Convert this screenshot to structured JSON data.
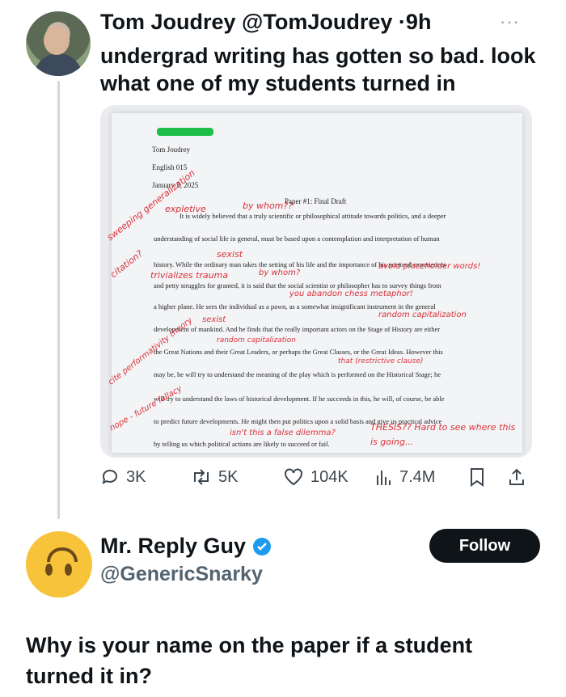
{
  "tweet": {
    "author_name": "Tom Joudrey",
    "author_handle": "@TomJoudrey",
    "separator": "·",
    "time": "9h",
    "text": "undergrad writing has gotten so bad. look what one of my students turned in",
    "more_icon": "more-dots-icon"
  },
  "paper": {
    "header_lines": [
      "Tom Joudrey",
      "English 015",
      "January 5, 2025"
    ],
    "title": "Paper #1: Final Draft",
    "body_lines": [
      "It is widely believed that a truly scientific or philosophical attitude towards politics, and a deeper",
      "understanding of social life in general, must be based upon a contemplation and interpretation of human",
      "history. While the ordinary man takes the setting of his life and the importance of his personal experiences",
      "and petty struggles for granted, it is said that the social scientist or philosopher has to survey things from",
      "a higher plane. He sees the individual as a pawn, as a somewhat insignificant instrument in the general",
      "development of mankind. And he finds that the really important actors on the Stage of History are either",
      "the Great Nations and their Great Leaders, or perhaps the Great Classes, or the Great Ideas. However this",
      "may be, he will try to understand the meaning of the play which is performed on the Historical Stage; he",
      "will try to understand the laws of historical development. If he succeeds in this, he will, of course, be able",
      "to predict future developments. He might then put politics upon a solid basis and give us practical advice",
      "by telling us which political actions are likely to succeed or fail."
    ],
    "annotations": [
      "sweeping generalization",
      "citation?",
      "expletive",
      "by whom??",
      "sexist",
      "trivializes trauma",
      "by whom?",
      "avoid placeholder words!",
      "you abandon chess metaphor!",
      "random capitalization",
      "sexist",
      "random capitalization",
      "cite performativity theory",
      "that (restrictive clause)",
      "nope - future fallacy",
      "isn't this a false dilemma?",
      "THESIS?? Hard to see where this is going..."
    ]
  },
  "actions": {
    "replies": "3K",
    "retweets": "5K",
    "likes": "104K",
    "views": "7.4M"
  },
  "reply": {
    "author_name": "Mr. Reply Guy",
    "author_handle": "@GenericSnarky",
    "follow_label": "Follow",
    "text": "Why is your name on the paper if a student turned it in?"
  },
  "colors": {
    "text": "#0f1419",
    "muted": "#536471",
    "verified": "#1d9bf0",
    "annotation_red": "#d8323a",
    "highlight_green": "#1dbf4a",
    "avatar_yellow": "#f6c33a"
  }
}
